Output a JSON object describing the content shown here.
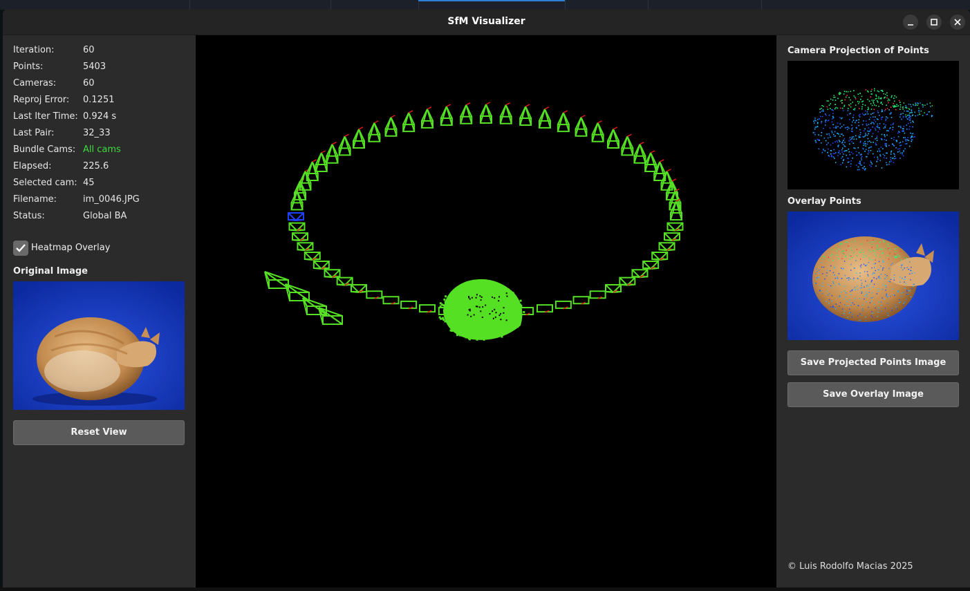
{
  "window": {
    "title": "SfM Visualizer"
  },
  "stats": [
    {
      "key": "Iteration:",
      "value": "60"
    },
    {
      "key": "Points:",
      "value": "5403"
    },
    {
      "key": "Cameras:",
      "value": "60"
    },
    {
      "key": "Reproj Error:",
      "value": "0.1251"
    },
    {
      "key": "Last Iter Time:",
      "value": "0.924 s"
    },
    {
      "key": "Last Pair:",
      "value": "32_33"
    },
    {
      "key": "Bundle Cams:",
      "value": "All cams"
    },
    {
      "key": "Elapsed:",
      "value": "225.6"
    },
    {
      "key": "Selected cam:",
      "value": "45"
    },
    {
      "key": "Filename:",
      "value": "im_0046.JPG"
    },
    {
      "key": "Status:",
      "value": "Global BA"
    }
  ],
  "controls": {
    "heatmap_label": "Heatmap Overlay",
    "heatmap_checked": true,
    "original_image_title": "Original Image",
    "reset_view_label": "Reset View"
  },
  "right_panel": {
    "projection_title": "Camera Projection of Points",
    "overlay_title": "Overlay Points",
    "save_projected_label": "Save Projected Points Image",
    "save_overlay_label": "Save Overlay Image",
    "copyright": "© Luis Rodolfo Macias 2025"
  },
  "colors": {
    "camera": "#55e024",
    "axis_red": "#e01818",
    "selected_camera": "#2040ff",
    "accent_green": "#3ddc3d"
  },
  "icons": {
    "minimize": "minimize-icon",
    "maximize": "maximize-icon",
    "close": "close-icon",
    "check": "check-icon"
  }
}
